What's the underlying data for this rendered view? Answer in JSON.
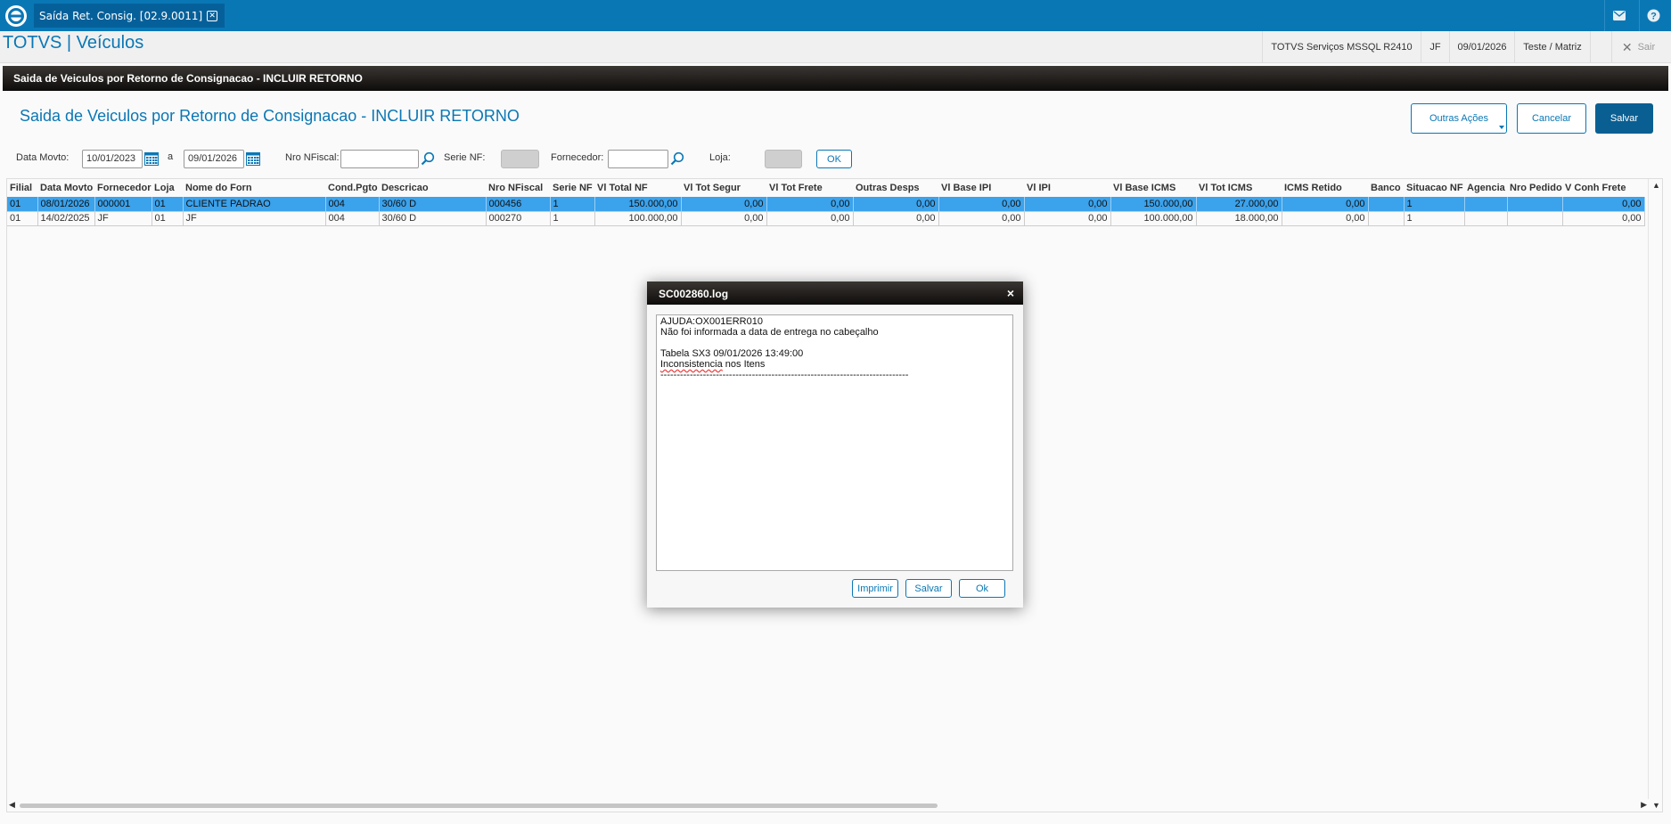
{
  "topbar": {
    "tab_label": "Saída Ret. Consig. [02.9.0011]",
    "tab_close": "⊗"
  },
  "header": {
    "brand": "TOTVS | Veículos",
    "environment": "TOTVS Serviços MSSQL R2410",
    "user": "JF",
    "date": "09/01/2026",
    "branch": "Teste / Matriz",
    "exit_label": "Sair"
  },
  "window": {
    "title": "Saida de Veiculos por Retorno de Consignacao - INCLUIR RETORNO"
  },
  "page": {
    "title": "Saida de Veiculos por Retorno de Consignacao - INCLUIR RETORNO",
    "other_actions": "Outras Ações",
    "cancel": "Cancelar",
    "save": "Salvar"
  },
  "filters": {
    "date_label": "Data Movto:",
    "date_from": "10/01/2023",
    "date_sep": "a",
    "date_to": "09/01/2026",
    "nf_label": "Nro NFiscal:",
    "serie_label": "Serie NF:",
    "supplier_label": "Fornecedor:",
    "store_label": "Loja:",
    "ok": "OK"
  },
  "grid": {
    "columns": [
      "Filial",
      "Data Movto",
      "Fornecedor",
      "Loja",
      "Nome do Forn",
      "Cond.Pgto",
      "Descricao",
      "Nro NFiscal",
      "Serie NF",
      "Vl Total NF",
      "Vl Tot Segur",
      "Vl Tot Frete",
      "Outras Desps",
      "Vl Base IPI",
      "Vl IPI",
      "Vl Base ICMS",
      "Vl Tot ICMS",
      "ICMS Retido",
      "Banco",
      "Situacao NF",
      "Agencia",
      "Nro Pedido",
      "V Conh Frete"
    ],
    "rows": [
      [
        "01",
        "08/01/2026",
        "000001",
        "01",
        "CLIENTE PADRAO",
        "004",
        "30/60 D",
        "000456",
        "1",
        "150.000,00",
        "0,00",
        "0,00",
        "0,00",
        "0,00",
        "0,00",
        "150.000,00",
        "27.000,00",
        "0,00",
        "",
        "1",
        "",
        "",
        "0,00"
      ],
      [
        "01",
        "14/02/2025",
        "JF",
        "01",
        "JF",
        "004",
        "30/60 D",
        "000270",
        "1",
        "100.000,00",
        "0,00",
        "0,00",
        "0,00",
        "0,00",
        "0,00",
        "100.000,00",
        "18.000,00",
        "0,00",
        "",
        "1",
        "",
        "",
        "0,00"
      ]
    ],
    "selected_row": 0
  },
  "modal": {
    "title": "SC002860.log",
    "close": "×",
    "line1": "AJUDA:OX001ERR010",
    "line2": "Não foi informada a data de entrega no cabeçalho",
    "line3": "Tabela SX3 09/01/2026 13:49:00",
    "line4_word": "Inconsistencia",
    "line4_rest": " nos Itens",
    "separator": "----------------------------------------------------------------------------",
    "print": "Imprimir",
    "save": "Salvar",
    "ok": "Ok"
  },
  "colors": {
    "brand_blue": "#0a77b5",
    "selected_row": "#3ba2ec",
    "title_bar": "#1a1715"
  }
}
